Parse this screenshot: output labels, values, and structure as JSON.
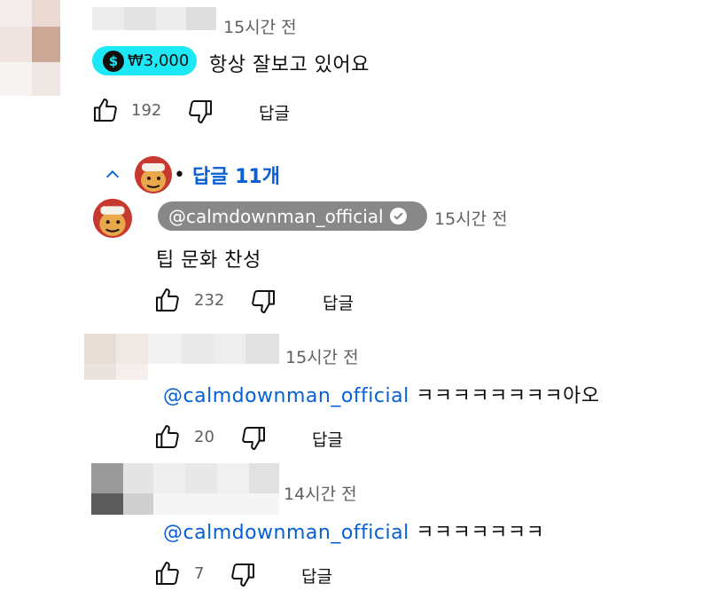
{
  "comments": [
    {
      "time": "15시간 전",
      "super_thanks": {
        "amount": "₩3,000",
        "icon": "dollar-coin-icon"
      },
      "text": "항상 잘보고 있어요",
      "likes": "192",
      "reply_label": "답글"
    }
  ],
  "replies_toggle": {
    "icon": "chevron-up-icon",
    "label": "답글 11개"
  },
  "replies": [
    {
      "author": "@calmdownman_official",
      "verified_icon": "check-circle-icon",
      "time": "15시간 전",
      "text": "팁 문화 찬성",
      "likes": "232",
      "reply_label": "답글"
    },
    {
      "time": "15시간 전",
      "mention": "@calmdownman_official",
      "text": " ㅋㅋㅋㅋㅋㅋㅋㅋ아오",
      "likes": "20",
      "reply_label": "답글"
    },
    {
      "time": "14시간 전",
      "mention": "@calmdownman_official",
      "text": " ㅋㅋㅋㅋㅋㅋㅋ",
      "likes": "7",
      "reply_label": "답글"
    }
  ],
  "colors": {
    "super_thanks": "#1de9f6",
    "owner_badge": "#888888",
    "mention": "#065fd4",
    "meta_text": "#606060"
  }
}
